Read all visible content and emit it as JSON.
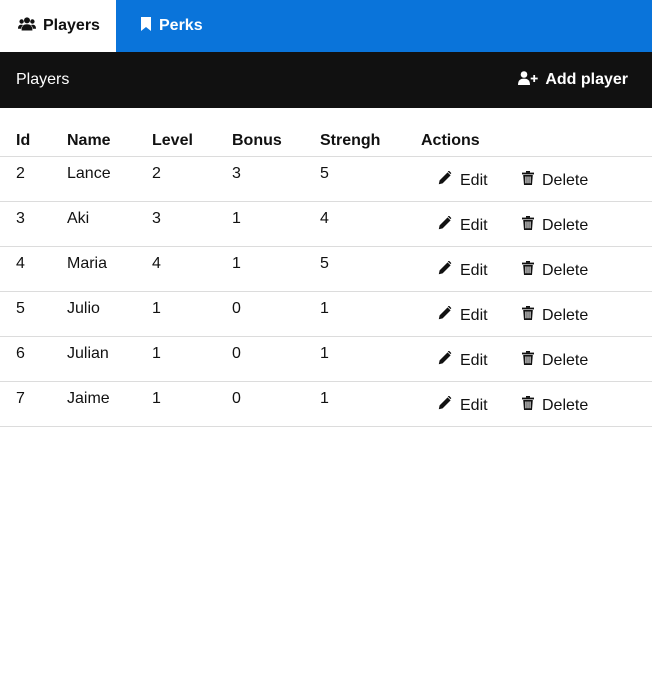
{
  "tabs": [
    {
      "label": "Players"
    },
    {
      "label": "Perks"
    }
  ],
  "header": {
    "title": "Players",
    "add_label": "Add player"
  },
  "table": {
    "columns": [
      "Id",
      "Name",
      "Level",
      "Bonus",
      "Strengh",
      "Actions"
    ],
    "rows": [
      {
        "id": "2",
        "name": "Lance",
        "level": "2",
        "bonus": "3",
        "strength": "5"
      },
      {
        "id": "3",
        "name": "Aki",
        "level": "3",
        "bonus": "1",
        "strength": "4"
      },
      {
        "id": "4",
        "name": "Maria",
        "level": "4",
        "bonus": "1",
        "strength": "5"
      },
      {
        "id": "5",
        "name": "Julio",
        "level": "1",
        "bonus": "0",
        "strength": "1"
      },
      {
        "id": "6",
        "name": "Julian",
        "level": "1",
        "bonus": "0",
        "strength": "1"
      },
      {
        "id": "7",
        "name": "Jaime",
        "level": "1",
        "bonus": "0",
        "strength": "1"
      }
    ],
    "edit_label": "Edit",
    "delete_label": "Delete"
  },
  "colors": {
    "tabbar": "#0a74da",
    "header": "#111111"
  },
  "icons": {
    "players_tab": "users-icon",
    "perks_tab": "bookmark-icon",
    "add": "user-plus-icon",
    "edit": "pencil-icon",
    "delete": "trash-icon"
  }
}
